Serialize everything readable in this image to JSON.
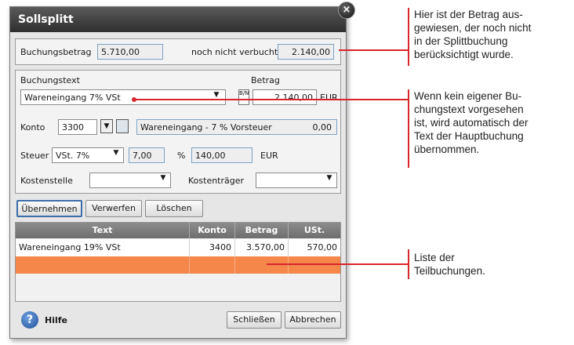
{
  "dialog": {
    "title": "Sollsplitt",
    "close_glyph": "×"
  },
  "summary": {
    "booking_amount_label": "Buchungsbetrag",
    "booking_amount_value": "5.710,00",
    "not_booked_label": "noch nicht verbucht",
    "not_booked_value": "2.140,00"
  },
  "form": {
    "text_label": "Buchungstext",
    "text_value": "Wareneingang 7% VSt",
    "amount_label": "Betrag",
    "amount_toggle": "B/N",
    "amount_value": "2.140,00",
    "amount_currency": "EUR",
    "account_label": "Konto",
    "account_value": "3300",
    "account_name": "Wareneingang - 7 % Vorsteuer",
    "account_balance": "0,00",
    "tax_label": "Steuer",
    "tax_value": "VSt. 7%",
    "tax_rate": "7,00",
    "tax_percent_sign": "%",
    "tax_amount": "140,00",
    "tax_currency": "EUR",
    "cost_center_label": "Kostenstelle",
    "cost_center_value": "",
    "cost_unit_label": "Kostenträger",
    "cost_unit_value": ""
  },
  "actions": {
    "apply": "Übernehmen",
    "discard": "Verwerfen",
    "delete": "Löschen"
  },
  "table": {
    "headers": [
      "Text",
      "Konto",
      "Betrag",
      "USt."
    ],
    "rows": [
      [
        "Wareneingang 19% VSt",
        "3400",
        "3.570,00",
        "570,00"
      ],
      [
        "",
        "",
        "",
        ""
      ]
    ]
  },
  "footer": {
    "help_label": "Hilfe",
    "close_label": "Schließen",
    "cancel_label": "Abbrechen"
  },
  "annotations": {
    "note1": [
      "Hier ist der Betrag aus-",
      "gewiesen, der noch nicht",
      "in der Splittbuchung",
      "berücksichtigt wurde."
    ],
    "note2": [
      "Wenn kein eigener Bu-",
      "chungstext vorgesehen",
      "ist, wird automatisch der",
      "Text der Hauptbuchung",
      "übernommen."
    ],
    "note3": [
      "Liste der",
      "Teilbuchungen."
    ]
  },
  "colors": {
    "accent_red": "#d9262c",
    "highlight_row": "#f5874a",
    "title_bar": "#3a3a3a"
  },
  "icons": {
    "close": "close-icon",
    "help": "help-icon",
    "dropdown": "chevron-down-icon",
    "account_lookup": "lookup-icon",
    "account_book": "account-book-icon"
  }
}
